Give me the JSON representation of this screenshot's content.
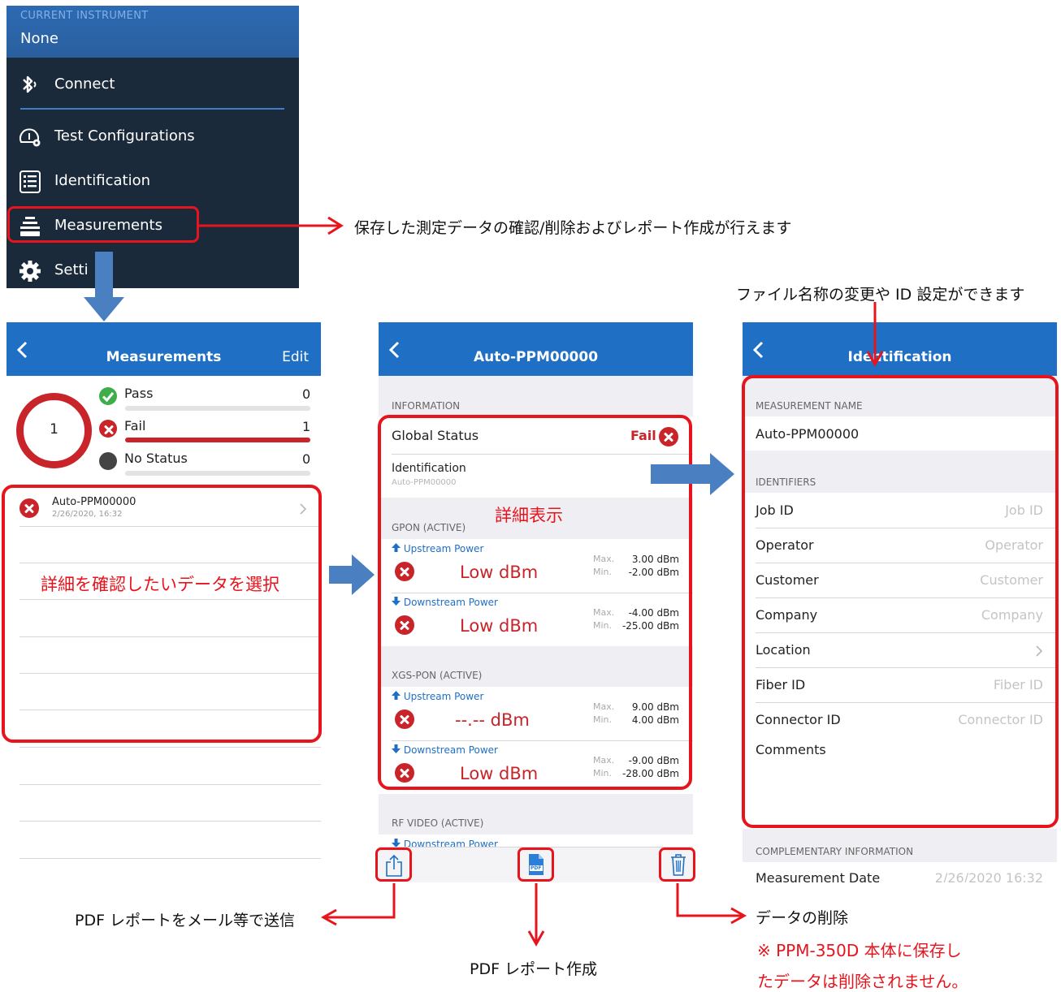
{
  "menu": {
    "instrument_label": "CURRENT INSTRUMENT",
    "instrument_value": "None",
    "items": [
      {
        "label": "Connect",
        "icon": "bluetooth-icon"
      },
      {
        "label": "Test Configurations",
        "icon": "test-config-icon"
      },
      {
        "label": "Identification",
        "icon": "identification-icon"
      },
      {
        "label": "Measurements",
        "icon": "measurements-icon"
      },
      {
        "label": "Setti",
        "icon": "gear-icon"
      }
    ]
  },
  "screen1": {
    "title": "Measurements",
    "edit": "Edit",
    "ring_count": "1",
    "stats": [
      {
        "label": "Pass",
        "value": "0"
      },
      {
        "label": "Fail",
        "value": "1"
      },
      {
        "label": "No Status",
        "value": "0"
      }
    ],
    "item": {
      "name": "Auto-PPM00000",
      "date": "2/26/2020, 16:32"
    }
  },
  "screen2": {
    "title": "Auto-PPM00000",
    "info_header": "INFORMATION",
    "global_status_label": "Global Status",
    "global_status_value": "Fail",
    "ident_label": "Identification",
    "ident_value": "Auto-PPM00000",
    "gpon_header": "GPON (ACTIVE)",
    "xgs_header": "XGS-PON (ACTIVE)",
    "rf_header": "RF VIDEO (ACTIVE)",
    "rf_first_row": "Downstream Power",
    "max_label": "Max.",
    "min_label": "Min.",
    "gpon": [
      {
        "name": "Upstream Power",
        "reading": "Low dBm",
        "max": "3.00 dBm",
        "min": "-2.00 dBm"
      },
      {
        "name": "Downstream Power",
        "reading": "Low dBm",
        "max": "-4.00 dBm",
        "min": "-25.00 dBm"
      }
    ],
    "xgs": [
      {
        "name": "Upstream Power",
        "reading": "--.-- dBm",
        "max": "9.00 dBm",
        "min": "4.00 dBm"
      },
      {
        "name": "Downstream Power",
        "reading": "Low dBm",
        "max": "-9.00 dBm",
        "min": "-28.00 dBm"
      }
    ],
    "pdf_icon_text": "PDF"
  },
  "screen3": {
    "title": "Identification",
    "name_header": "MEASUREMENT NAME",
    "name_value": "Auto-PPM00000",
    "ids_header": "IDENTIFIERS",
    "fields": [
      {
        "label": "Job ID",
        "placeholder": "Job ID"
      },
      {
        "label": "Operator",
        "placeholder": "Operator"
      },
      {
        "label": "Customer",
        "placeholder": "Customer"
      },
      {
        "label": "Company",
        "placeholder": "Company"
      },
      {
        "label": "Location",
        "placeholder": ""
      },
      {
        "label": "Fiber ID",
        "placeholder": "Fiber ID"
      },
      {
        "label": "Connector ID",
        "placeholder": "Connector ID"
      }
    ],
    "comments_label": "Comments",
    "comp_header": "COMPLEMENTARY INFORMATION",
    "meas_date_label": "Measurement Date",
    "meas_date_value": "2/26/2020 16:32"
  },
  "annotations": {
    "measurements": "保存した測定データの確認/削除およびレポート作成が行えます",
    "rename": "ファイル名称の変更や ID 設定ができます",
    "select": "詳細を確認したいデータを選択",
    "detail": "詳細表示",
    "send_pdf": "PDF レポートをメール等で送信",
    "create_pdf": "PDF レポート作成",
    "delete": "データの削除",
    "note_line1": "※  PPM-350D 本体に保存し",
    "note_line2": "たデータは削除されません。"
  },
  "colors": {
    "nav_blue": "#1f6fc4",
    "menu_bg": "#1b2a3a",
    "fail_red": "#c8242a",
    "annotation_red": "#e8141d",
    "arrow_blue": "#4a7fc1"
  }
}
